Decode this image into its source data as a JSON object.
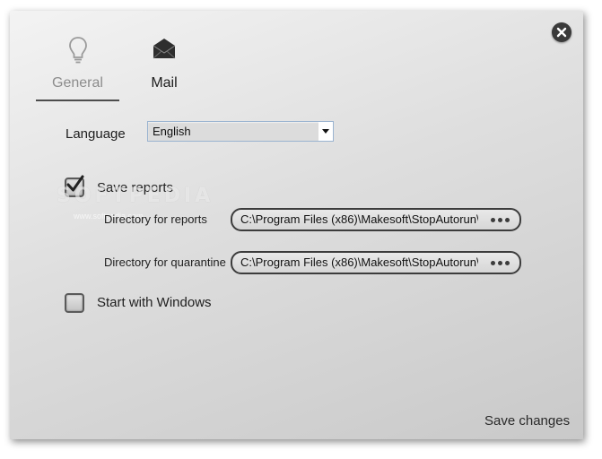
{
  "tabs": [
    {
      "label": "General",
      "icon": "lightbulb-icon",
      "active": true
    },
    {
      "label": "Mail",
      "icon": "envelope-icon",
      "active": false
    }
  ],
  "language": {
    "label": "Language",
    "selected": "English"
  },
  "save_reports": {
    "label": "Save reports",
    "checked": true
  },
  "directories": {
    "reports": {
      "label": "Directory for reports",
      "value": "C:\\Program Files (x86)\\Makesoft\\StopAutorun\\"
    },
    "quarantine": {
      "label": "Directory for quarantine",
      "value": "C:\\Program Files (x86)\\Makesoft\\StopAutorun\\"
    },
    "browse_label": "•••"
  },
  "start_with_windows": {
    "label": "Start with Windows",
    "checked": false
  },
  "footer": {
    "save_changes": "Save changes"
  },
  "watermark": {
    "text": "SOFTPEDIA",
    "url": "www.softpedia.com"
  },
  "colors": {
    "accent_dark": "#3a3a3a",
    "inactive_tab_text": "#8c8c8c",
    "select_border": "#9ab3d0"
  }
}
